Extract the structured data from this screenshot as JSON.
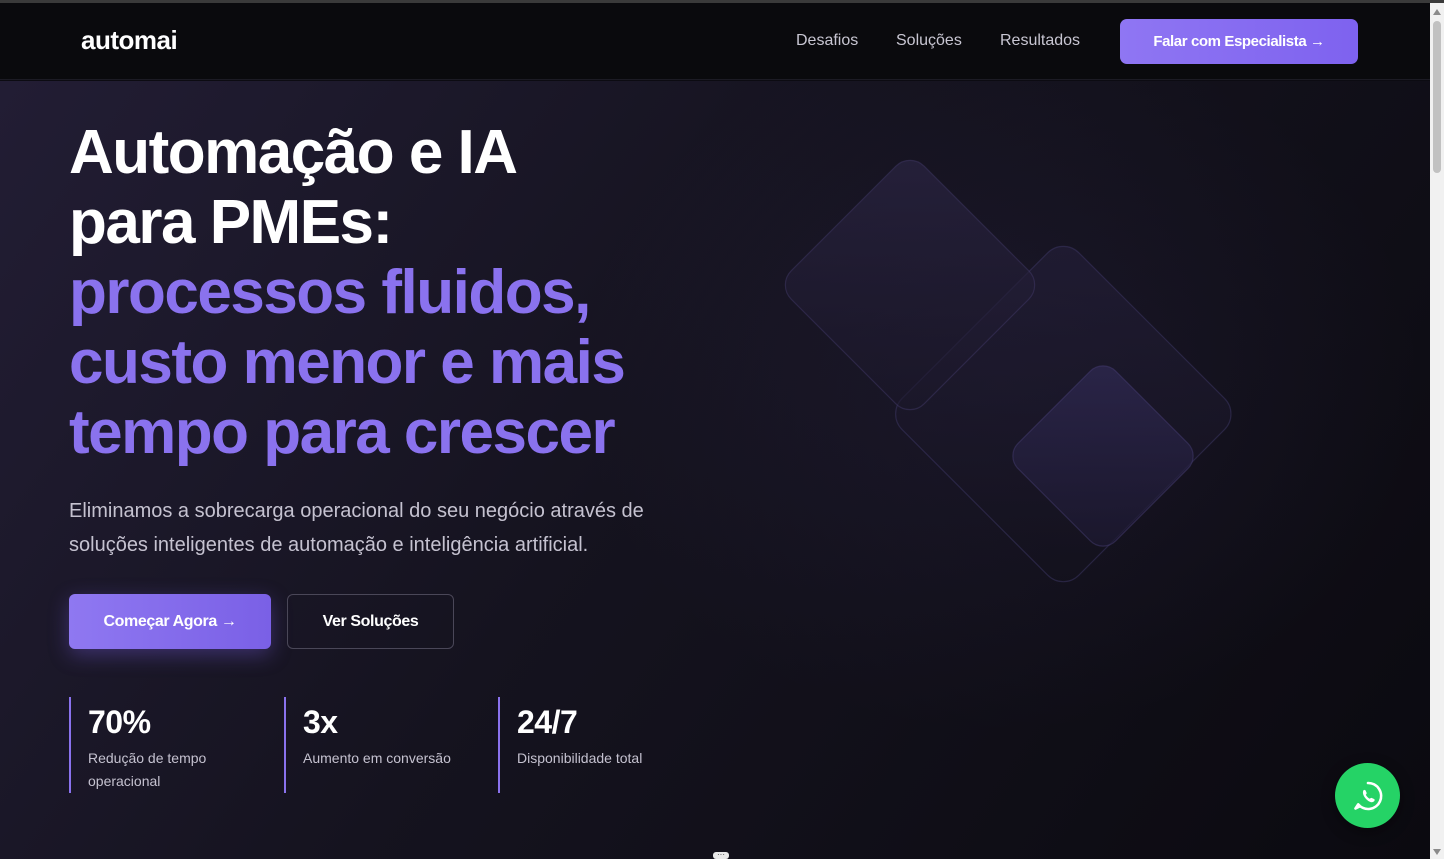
{
  "nav": {
    "logo": "automai",
    "links": [
      "Desafios",
      "Soluções",
      "Resultados"
    ],
    "cta": "Falar com Especialista →"
  },
  "hero": {
    "headline_white": [
      "Automação e IA",
      "para PMEs:"
    ],
    "headline_purple": [
      "processos fluidos,",
      "custo menor e mais",
      "tempo para crescer"
    ],
    "subtitle": "Eliminamos a sobrecarga operacional do seu negócio através de soluções inteligentes de automação e inteligência artificial.",
    "primary_button": "Começar Agora →",
    "secondary_button": "Ver Soluções",
    "stats": [
      {
        "value": "70%",
        "label": "Redução de tempo operacional"
      },
      {
        "value": "3x",
        "label": "Aumento em conversão"
      },
      {
        "value": "24/7",
        "label": "Disponibilidade total"
      }
    ]
  },
  "icons": {
    "whatsapp": "whatsapp-icon"
  },
  "colors": {
    "accent": "#8a72ee",
    "whatsapp": "#25d366",
    "background": "#0c0b12"
  }
}
